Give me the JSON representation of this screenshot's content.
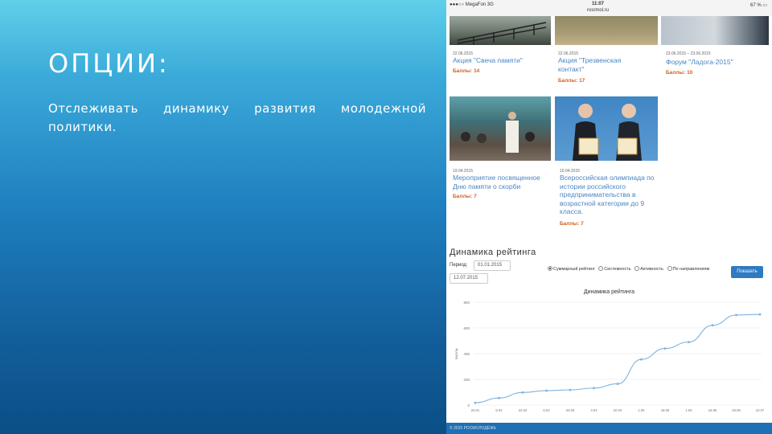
{
  "slide": {
    "title": "ОПЦИИ:",
    "body": "Отслеживать динамику развития молодежной политики."
  },
  "status_bar": {
    "left": "●●●○○ MegaFon  3G",
    "time": "11:07",
    "subtitle": "rosrmol.ru",
    "right": "67 % ▭"
  },
  "cards": [
    {
      "date": "22.06.2015",
      "title": "Акция \"Свеча памяти\"",
      "score": "Баллы: 14"
    },
    {
      "date": "22.06.2015",
      "title": "Акция \"Трезвенская контакт\"",
      "score": "Баллы: 17"
    },
    {
      "date": "23.06.2015 – 23.06.2015",
      "title": "Форум \"Ладога-2015\"",
      "score": "Баллы: 10"
    },
    {
      "date": "19.04.2015",
      "title": "Мероприятие посвященное Дню памяти о скорби",
      "score": "Баллы: 7"
    },
    {
      "date": "10.04.2015",
      "title": "Всероссийская олимпиада по истории российского предпринимательства в возрастной категории до 9 класса.",
      "score": "Баллы: 7"
    }
  ],
  "rating": {
    "section_title": "Динамика рейтинга",
    "period_label": "Период",
    "date_from": "01.01.2015",
    "date_to": "12.07.2015",
    "options": [
      "Суммарный рейтинг",
      "Системность",
      "Активность",
      "По направлениям"
    ],
    "selected_option": "Суммарный рейтинг",
    "show_button": "Показать"
  },
  "chart_data": {
    "type": "line",
    "title": "Динамика рейтинга",
    "ylabel": "Баллы",
    "xlabel": "",
    "ylim": [
      0,
      800
    ],
    "yticks": [
      0,
      200,
      400,
      600,
      800
    ],
    "categories": [
      "20.01",
      "5.02",
      "22.02",
      "6.03",
      "20.03",
      "3.04",
      "20.04",
      "1.05",
      "18.05",
      "1.06",
      "18.06",
      "26.06",
      "10.07"
    ],
    "values": [
      18,
      55,
      98,
      112,
      118,
      132,
      165,
      355,
      440,
      490,
      620,
      700,
      705
    ],
    "grid": true,
    "legend": "none",
    "color": "#7fb2dc"
  },
  "footer": {
    "text": "© 2015 РОСМОЛОДЕЖЬ"
  }
}
